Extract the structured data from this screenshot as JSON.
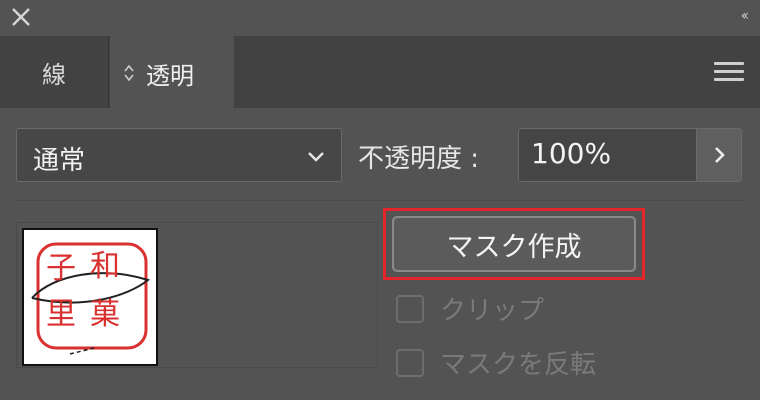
{
  "titlebar": {
    "close_icon": "close-icon",
    "collapse_glyph": "‹‹"
  },
  "tabs": [
    {
      "label": "線"
    },
    {
      "label": "透明"
    }
  ],
  "panel_menu_icon": "hamburger-menu-icon",
  "blend_mode": {
    "value": "通常"
  },
  "opacity": {
    "label": "不透明度 :",
    "value": "100%"
  },
  "thumbnail": {
    "seal_chars": [
      "子",
      "和",
      "里",
      "菓"
    ]
  },
  "mask_button": {
    "label": "マスク作成"
  },
  "options": {
    "clip": {
      "label": "クリップ",
      "checked": false,
      "enabled": false
    },
    "invert": {
      "label": "マスクを反転",
      "checked": false,
      "enabled": false
    }
  },
  "colors": {
    "panel_bg": "#535353",
    "tab_bar_bg": "#424242",
    "highlight": "#e3262c",
    "seal_red": "#d93030"
  }
}
